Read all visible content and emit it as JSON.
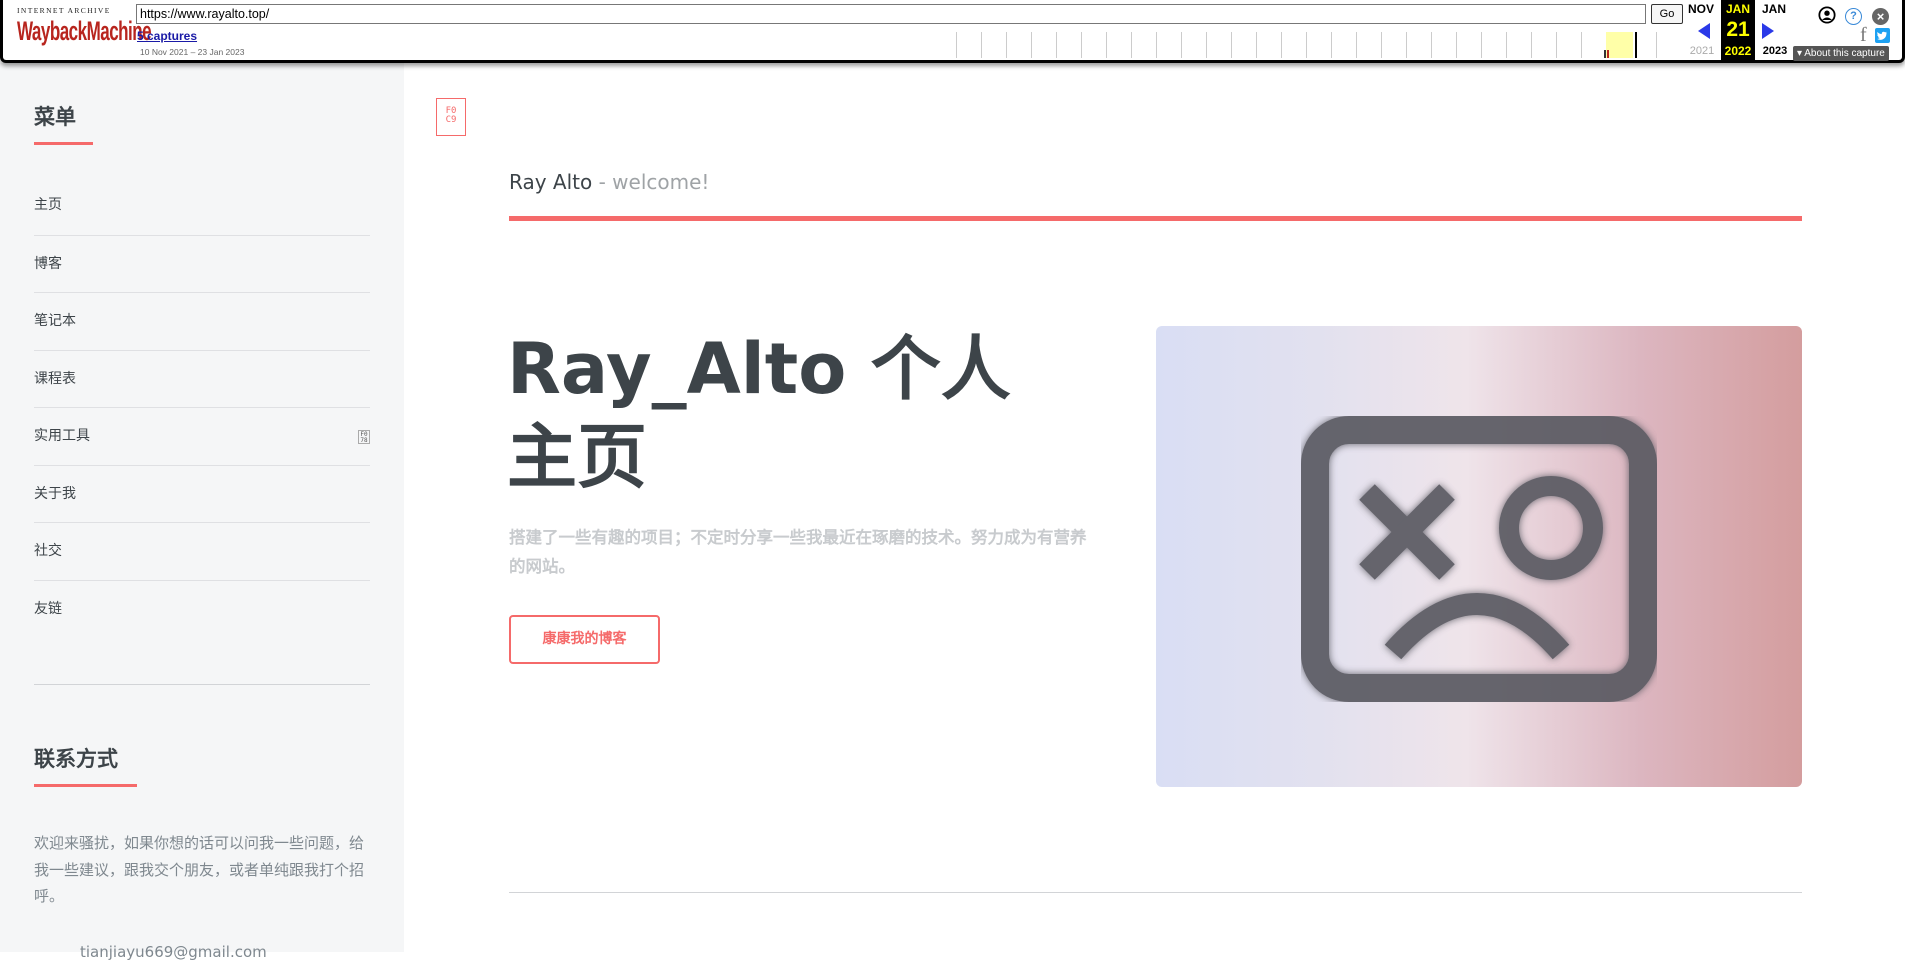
{
  "wayback": {
    "logo_top": "INTERNET ARCHIVE",
    "logo_wayback": "WaybackMachine",
    "url": "https://www.rayalto.top/",
    "go_label": "Go",
    "captures": "5 captures",
    "range": "10 Nov 2021 – 23 Jan 2023",
    "prev_month": "NOV",
    "cur_month": "JAN",
    "cur_day": "21",
    "cur_year": "2022",
    "next_month": "JAN",
    "prev_year": "2021",
    "next_year": "2023",
    "about": "▾ About this capture",
    "help_glyph": "?",
    "close_glyph": "×",
    "facebook_glyph": "f",
    "icons": [
      "user-icon",
      "help-icon",
      "close-icon",
      "facebook-icon",
      "twitter-icon",
      "prev-arrow-icon",
      "next-arrow-icon"
    ]
  },
  "sidebar": {
    "menu_title": "菜单",
    "items": [
      {
        "label": "主页"
      },
      {
        "label": "博客"
      },
      {
        "label": "笔记本"
      },
      {
        "label": "课程表"
      },
      {
        "label": "实用工具"
      },
      {
        "label": "关于我"
      },
      {
        "label": "社交"
      },
      {
        "label": "友链"
      }
    ],
    "contact_title": "联系方式",
    "contact_text": "欢迎来骚扰，如果你想的话可以问我一些问题，给我一些建议，跟我交个朋友，或者单纯跟我打个招呼。",
    "email": "tianjiayu669@gmail.com"
  },
  "main": {
    "header_name": "Ray Alto",
    "header_sub": " - welcome!",
    "hero_title": "Ray_Alto 个人主页",
    "hero_text": "搭建了一些有趣的项目；不定时分享一些我最近在琢磨的技术。努力成为有营养的网站。",
    "hero_button": "康康我的博客"
  },
  "colors": {
    "accent": "#f56a6a",
    "text": "#3d4449",
    "sidebar_bg": "#f5f6f7",
    "wayback_red": "#b8251e",
    "wayback_blue": "#2a39e8"
  }
}
